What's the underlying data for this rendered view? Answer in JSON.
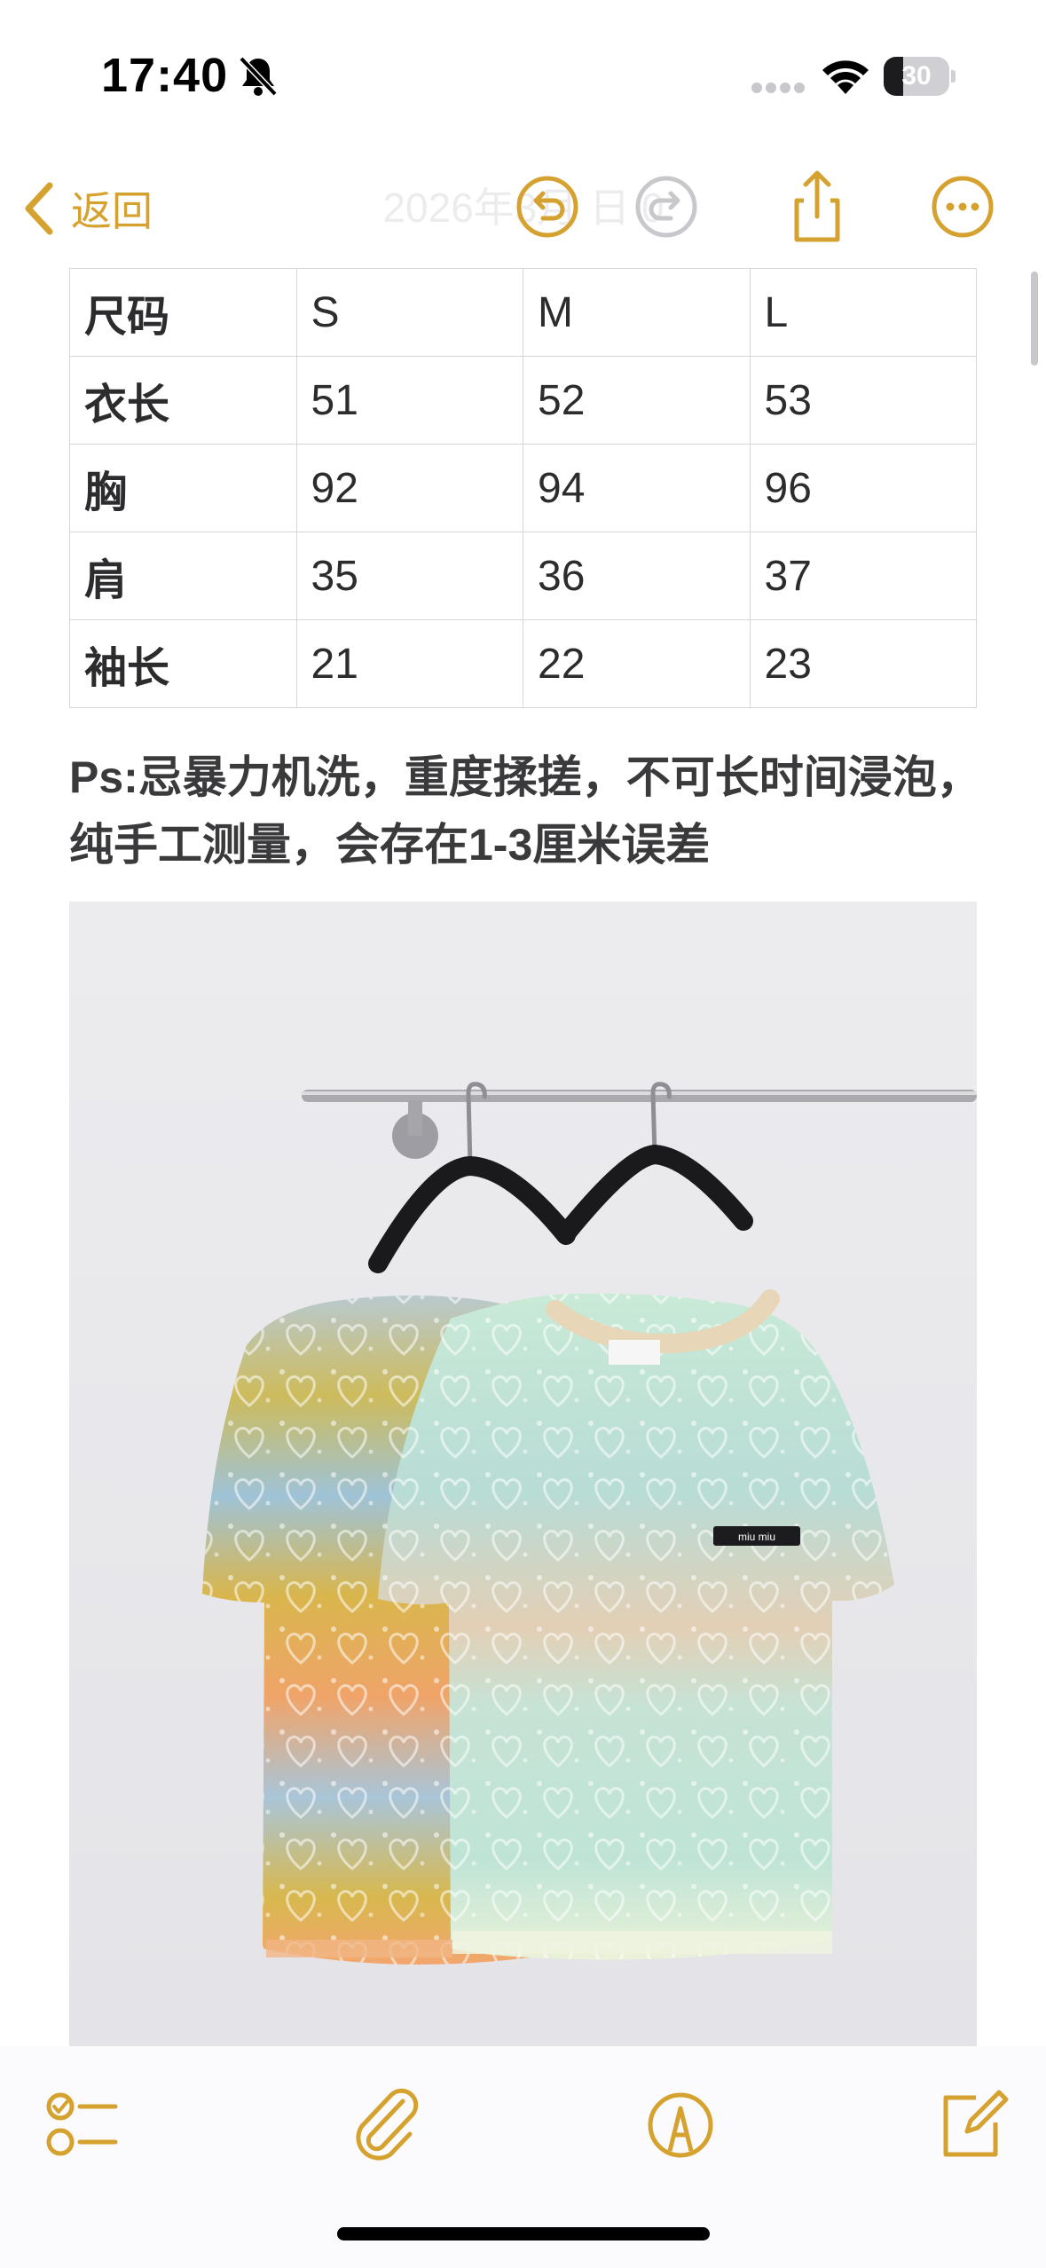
{
  "status_bar": {
    "time": "17:40",
    "battery_level": "30",
    "icons": [
      "bell-slash-icon",
      "cellular-signal-icon",
      "wifi-icon",
      "battery-icon"
    ]
  },
  "nav": {
    "back_label": "返回",
    "date_title": "2026年3月 日 0",
    "accent_color": "#d6a22f",
    "icons": [
      "chevron-left-icon",
      "undo-icon",
      "redo-icon",
      "share-icon",
      "more-icon"
    ]
  },
  "size_table": {
    "rows": [
      [
        "尺码",
        "S",
        "M",
        "L"
      ],
      [
        "衣长",
        "51",
        "52",
        "53"
      ],
      [
        "胸",
        "92",
        "94",
        "96"
      ],
      [
        "肩",
        "35",
        "36",
        "37"
      ],
      [
        "袖长",
        "21",
        "22",
        "23"
      ]
    ]
  },
  "note": {
    "text": "Ps:忌暴力机洗，重度揉搓，不可长时间浸泡，纯手工测量，会存在1-3厘米误差"
  },
  "photo": {
    "label_text": "miu miu"
  },
  "toolbar": {
    "icons": [
      "checklist-icon",
      "paperclip-icon",
      "markup-pen-icon",
      "compose-icon"
    ]
  }
}
